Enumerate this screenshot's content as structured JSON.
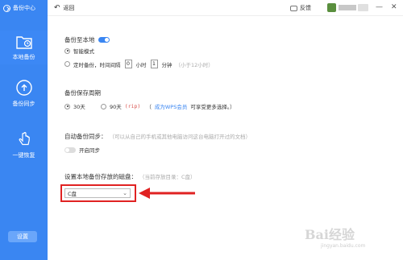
{
  "sidebar": {
    "title": "备份中心",
    "items": [
      {
        "label": "本地备份",
        "icon": "folder-clock-icon"
      },
      {
        "label": "备份同步",
        "icon": "cloud-upload-icon"
      },
      {
        "label": "一键恢复",
        "icon": "hand-tap-icon"
      }
    ],
    "settings_label": "设置"
  },
  "topbar": {
    "back_label": "返回",
    "feedback_label": "反馈",
    "minimize": "—",
    "close": "✕"
  },
  "local_backup": {
    "heading": "备份至本地",
    "toggle_on": true,
    "smart_mode_label": "智能模式",
    "timed_prefix": "定时备份，时间间隔",
    "hours_value": "0",
    "hours_unit": "小时",
    "minutes_value": "1",
    "minutes_unit": "分钟",
    "timed_hint": "（小于12小时）"
  },
  "retention": {
    "heading": "备份保存周期",
    "opt30": "30天",
    "opt90": "90天",
    "rip": "(rip)",
    "paren_open": "（",
    "wps_link": "成为WPS会员",
    "wps_suffix": "可享受更多选择。）"
  },
  "auto_sync": {
    "heading": "自动备份同步：",
    "hint": "（可以从自己的手机或其他电脑访问这台电脑打开过的文档）",
    "toggle_label": "开启同步"
  },
  "disk": {
    "heading": "设置本地备份存放的磁盘：",
    "hint": "（当前存放目录：C盘）",
    "selected": "C盘"
  },
  "watermark": {
    "text": "Bai经验",
    "sub": "jingyan.baidu.com"
  },
  "colors": {
    "sidebar": "#3a86f2",
    "accent": "#3a86f2",
    "annotation": "#e02222"
  }
}
